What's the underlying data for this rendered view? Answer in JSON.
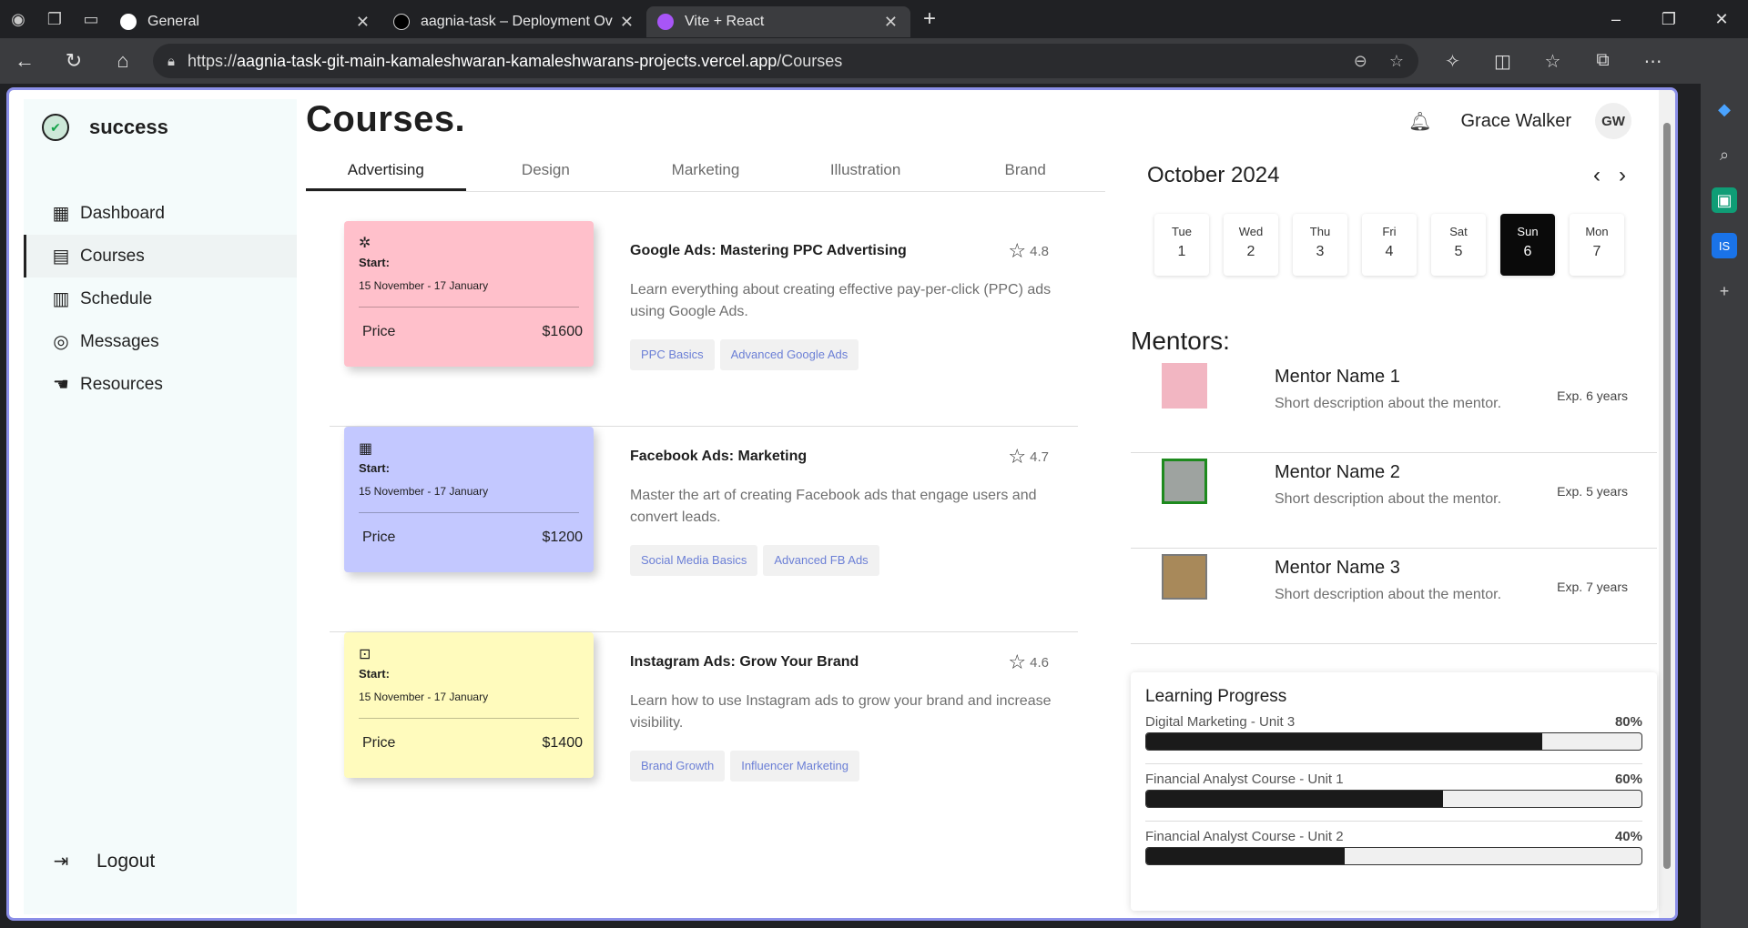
{
  "browser": {
    "tabs": [
      {
        "title": "General",
        "active": false,
        "favicon_color": "#ffffff"
      },
      {
        "title": "aagnia-task – Deployment Overvi",
        "active": false,
        "favicon_color": "#000000"
      },
      {
        "title": "Vite + React",
        "active": true,
        "favicon_color": "#a855f7"
      }
    ],
    "url_scheme": "https://",
    "url_host": "aagnia-task-git-main-kamaleshwaran-kamaleshwarans-projects.vercel.app",
    "url_path": "/Courses"
  },
  "sidebar": {
    "brand": "success",
    "items": [
      {
        "label": "Dashboard",
        "icon": "dashboard-icon",
        "glyph": "▦",
        "active": false
      },
      {
        "label": "Courses",
        "icon": "courses-icon",
        "glyph": "▤",
        "active": true
      },
      {
        "label": "Schedule",
        "icon": "calendar-icon",
        "glyph": "▥",
        "active": false
      },
      {
        "label": "Messages",
        "icon": "chat-icon",
        "glyph": "◎",
        "active": false
      },
      {
        "label": "Resources",
        "icon": "hand-icon",
        "glyph": "☚",
        "active": false
      }
    ],
    "logout": "Logout"
  },
  "header": {
    "title": "Courses.",
    "user_name": "Grace Walker",
    "user_initials": "GW"
  },
  "course_tabs": [
    "Advertising",
    "Design",
    "Marketing",
    "Illustration",
    "Brand"
  ],
  "courses": [
    {
      "title": "Google Ads: Mastering PPC Advertising",
      "rating": "4.8",
      "start_label": "Start:",
      "dates": "15 November - 17 January",
      "price_label": "Price",
      "price": "$1600",
      "color": "#ffc0cb",
      "icon_glyph": "✲",
      "description": "Learn everything about creating effective pay-per-click (PPC) ads using Google Ads.",
      "tags": [
        "PPC Basics",
        "Advanced Google Ads"
      ]
    },
    {
      "title": "Facebook Ads: Marketing",
      "rating": "4.7",
      "start_label": "Start:",
      "dates": "15 November - 17 January",
      "price_label": "Price",
      "price": "$1200",
      "color": "#c3c8ff",
      "icon_glyph": "▦",
      "description": "Master the art of creating Facebook ads that engage users and convert leads.",
      "tags": [
        "Social Media Basics",
        "Advanced FB Ads"
      ]
    },
    {
      "title": "Instagram Ads: Grow Your Brand",
      "rating": "4.6",
      "start_label": "Start:",
      "dates": "15 November - 17 January",
      "price_label": "Price",
      "price": "$1400",
      "color": "#fffbbd",
      "icon_glyph": "⊡",
      "description": "Learn how to use Instagram ads to grow your brand and increase visibility.",
      "tags": [
        "Brand Growth",
        "Influencer Marketing"
      ]
    }
  ],
  "calendar": {
    "month": "October 2024",
    "days": [
      {
        "name": "Tue",
        "num": "1",
        "active": false
      },
      {
        "name": "Wed",
        "num": "2",
        "active": false
      },
      {
        "name": "Thu",
        "num": "3",
        "active": false
      },
      {
        "name": "Fri",
        "num": "4",
        "active": false
      },
      {
        "name": "Sat",
        "num": "5",
        "active": false
      },
      {
        "name": "Sun",
        "num": "6",
        "active": true
      },
      {
        "name": "Mon",
        "num": "7",
        "active": false
      }
    ]
  },
  "mentors": {
    "title": "Mentors:",
    "items": [
      {
        "name": "Mentor Name 1",
        "desc": "Short description about the mentor.",
        "exp": "Exp. 6 years",
        "photo_color": "#f2b6c2",
        "border": "#f2b6c2"
      },
      {
        "name": "Mentor Name 2",
        "desc": "Short description about the mentor.",
        "exp": "Exp. 5 years",
        "photo_color": "#9ea3a0",
        "border": "#1e8a1e"
      },
      {
        "name": "Mentor Name 3",
        "desc": "Short description about the mentor.",
        "exp": "Exp. 7 years",
        "photo_color": "#a8895a",
        "border": "#7a7a7a"
      }
    ]
  },
  "progress": {
    "title": "Learning Progress",
    "items": [
      {
        "label": "Digital Marketing - Unit 3",
        "percent": "80%",
        "value": 80
      },
      {
        "label": "Financial Analyst Course - Unit 1",
        "percent": "60%",
        "value": 60
      },
      {
        "label": "Financial Analyst Course - Unit 2",
        "percent": "40%",
        "value": 40
      }
    ]
  }
}
